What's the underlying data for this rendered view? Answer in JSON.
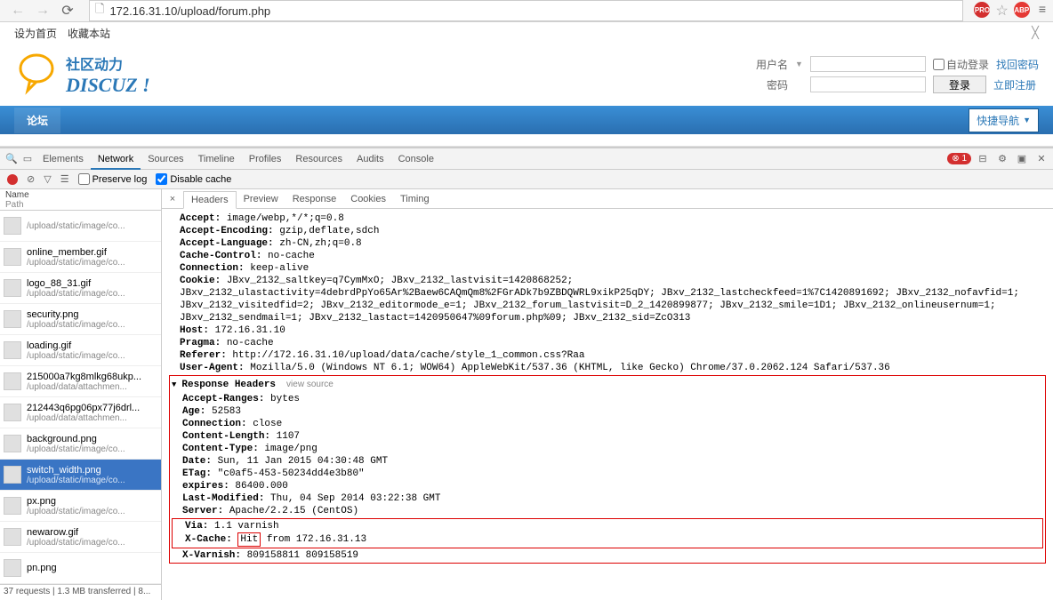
{
  "browser": {
    "url": "172.16.31.10/upload/forum.php",
    "ext_pro": "PRO",
    "ext_abp": "ABP"
  },
  "site": {
    "set_home": "设为首页",
    "collect": "收藏本站",
    "logo_cn": "社区动力",
    "logo_en": "DISCUZ !",
    "username_label": "用户名",
    "password_label": "密码",
    "auto_login": "自动登录",
    "find_pwd": "找回密码",
    "login_btn": "登录",
    "register": "立即注册",
    "forum_tab": "论坛",
    "quick_nav": "快捷导航"
  },
  "devtools": {
    "tabs": [
      "Elements",
      "Network",
      "Sources",
      "Timeline",
      "Profiles",
      "Resources",
      "Audits",
      "Console"
    ],
    "active_tab": "Network",
    "errors": "1",
    "preserve_log": "Preserve log",
    "disable_cache": "Disable cache",
    "name_header": "Name",
    "path_header": "Path",
    "detail_tabs": [
      "Headers",
      "Preview",
      "Response",
      "Cookies",
      "Timing"
    ],
    "active_detail_tab": "Headers",
    "footer": "37 requests | 1.3 MB transferred | 8...",
    "requests": [
      {
        "name": "",
        "path": "/upload/static/image/co..."
      },
      {
        "name": "online_member.gif",
        "path": "/upload/static/image/co..."
      },
      {
        "name": "logo_88_31.gif",
        "path": "/upload/static/image/co..."
      },
      {
        "name": "security.png",
        "path": "/upload/static/image/co..."
      },
      {
        "name": "loading.gif",
        "path": "/upload/static/image/co..."
      },
      {
        "name": "215000a7kg8mlkg68ukp...",
        "path": "/upload/data/attachmen..."
      },
      {
        "name": "212443q6pg06px77j6drl...",
        "path": "/upload/data/attachmen..."
      },
      {
        "name": "background.png",
        "path": "/upload/static/image/co..."
      },
      {
        "name": "switch_width.png",
        "path": "/upload/static/image/co...",
        "selected": true
      },
      {
        "name": "px.png",
        "path": "/upload/static/image/co..."
      },
      {
        "name": "newarow.gif",
        "path": "/upload/static/image/co..."
      },
      {
        "name": "pn.png",
        "path": ""
      }
    ],
    "request_headers": [
      {
        "k": "Accept",
        "v": "image/webp,*/*;q=0.8"
      },
      {
        "k": "Accept-Encoding",
        "v": "gzip,deflate,sdch"
      },
      {
        "k": "Accept-Language",
        "v": "zh-CN,zh;q=0.8"
      },
      {
        "k": "Cache-Control",
        "v": "no-cache"
      },
      {
        "k": "Connection",
        "v": "keep-alive"
      },
      {
        "k": "Cookie",
        "v": "JBxv_2132_saltkey=q7CymMxO; JBxv_2132_lastvisit=1420868252; JBxv_2132_ulastactivity=4debrdPpYo65Ar%2Baew6CAQmQm8%2FGrADk7b9ZBDQWRL9xikP25qDY; JBxv_2132_lastcheckfeed=1%7C1420891692; JBxv_2132_nofavfid=1; JBxv_2132_visitedfid=2; JBxv_2132_editormode_e=1; JBxv_2132_forum_lastvisit=D_2_1420899877; JBxv_2132_smile=1D1; JBxv_2132_onlineusernum=1; JBxv_2132_sendmail=1; JBxv_2132_lastact=1420950647%09forum.php%09; JBxv_2132_sid=ZcO313"
      },
      {
        "k": "Host",
        "v": "172.16.31.10"
      },
      {
        "k": "Pragma",
        "v": "no-cache"
      },
      {
        "k": "Referer",
        "v": "http://172.16.31.10/upload/data/cache/style_1_common.css?Raa"
      },
      {
        "k": "User-Agent",
        "v": "Mozilla/5.0 (Windows NT 6.1; WOW64) AppleWebKit/537.36 (KHTML, like Gecko) Chrome/37.0.2062.124 Safari/537.36"
      }
    ],
    "response_section": "Response Headers",
    "view_source": "view source",
    "response_headers": [
      {
        "k": "Accept-Ranges",
        "v": "bytes"
      },
      {
        "k": "Age",
        "v": "52583"
      },
      {
        "k": "Connection",
        "v": "close"
      },
      {
        "k": "Content-Length",
        "v": "1107"
      },
      {
        "k": "Content-Type",
        "v": "image/png"
      },
      {
        "k": "Date",
        "v": "Sun, 11 Jan 2015 04:30:48 GMT"
      },
      {
        "k": "ETag",
        "v": "\"c0af5-453-50234dd4e3b80\""
      },
      {
        "k": "expires",
        "v": "86400.000"
      },
      {
        "k": "Last-Modified",
        "v": "Thu, 04 Sep 2014 03:22:38 GMT"
      },
      {
        "k": "Server",
        "v": "Apache/2.2.15 (CentOS)"
      }
    ],
    "via_label": "Via",
    "via_value": "1.1 varnish",
    "xcache_label": "X-Cache",
    "xcache_hit": "Hit",
    "xcache_rest": "from 172.16.31.13",
    "xvarnish_label": "X-Varnish",
    "xvarnish_value": "809158811 809158519"
  }
}
